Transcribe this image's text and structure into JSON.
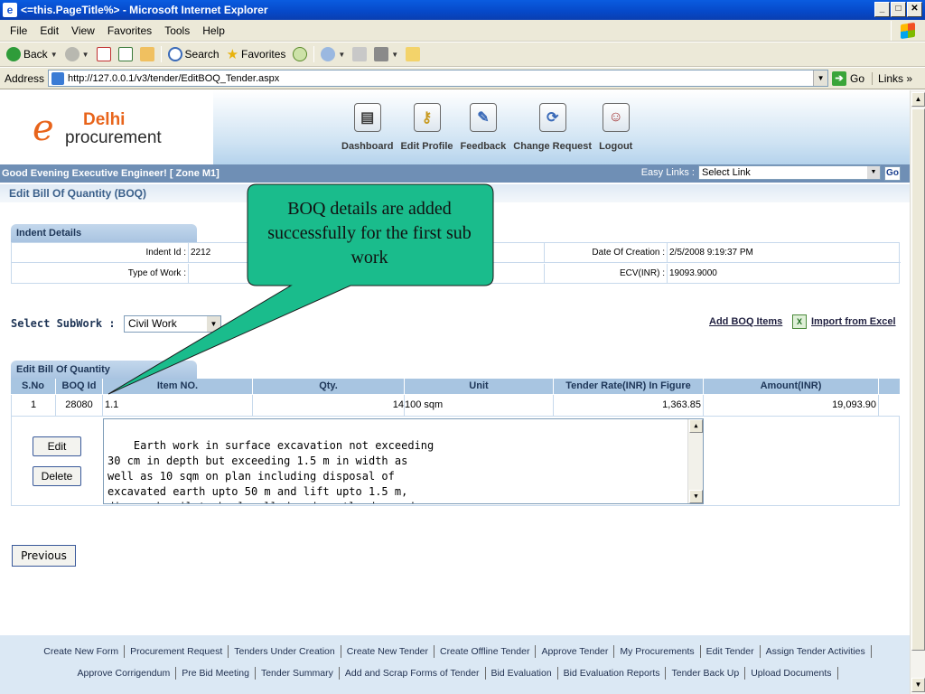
{
  "window": {
    "title": "<=this.PageTitle%> - Microsoft Internet Explorer",
    "min": "_",
    "max": "□",
    "close": "✕"
  },
  "menu": [
    "File",
    "Edit",
    "View",
    "Favorites",
    "Tools",
    "Help"
  ],
  "toolbar": {
    "back": "Back",
    "search": "Search",
    "favorites": "Favorites"
  },
  "address": {
    "label": "Address",
    "url": "http://127.0.0.1/v3/tender/EditBOQ_Tender.aspx",
    "go": "Go",
    "links": "Links"
  },
  "logo": {
    "line1": "Delhi",
    "line2": "procurement",
    "e_letter": "e"
  },
  "nav": [
    {
      "label": "Dashboard",
      "icon": "dashboard-icon"
    },
    {
      "label": "Edit Profile",
      "icon": "key-icon"
    },
    {
      "label": "Feedback",
      "icon": "feedback-icon"
    },
    {
      "label": "Change Request",
      "icon": "change-request-icon"
    },
    {
      "label": "Logout",
      "icon": "logout-icon"
    }
  ],
  "greeting": "Good Evening Executive Engineer!  [ Zone M1]",
  "easy_links": {
    "label": "Easy Links :",
    "selected": "Select Link",
    "go": "Go"
  },
  "page_title": "Edit Bill Of Quantity (BOQ)",
  "indent": {
    "section": "Indent Details",
    "indent_id_label": "Indent Id :",
    "indent_id": "2212",
    "type_label": "Type of Work :",
    "type": "",
    "creation_label": "Date Of Creation :",
    "creation": "2/5/2008 9:19:37 PM",
    "ecv_label": "ECV(INR) :",
    "ecv": "19093.9000"
  },
  "subwork": {
    "label": "Select SubWork :",
    "selected": "Civil Work",
    "add_boq": "Add BOQ Items",
    "import_excel": "Import from Excel"
  },
  "boq": {
    "section": "Edit Bill Of Quantity",
    "columns": [
      "S.No",
      "BOQ Id",
      "Item NO.",
      "Qty.",
      "Unit",
      "Tender Rate(INR) In Figure",
      "Amount(INR)"
    ],
    "row": {
      "sno": "1",
      "boq_id": "28080",
      "item_no": "1.1",
      "qty": "14",
      "unit": "100 sqm",
      "rate": "1,363.85",
      "amount": "19,093.90"
    },
    "description": "Earth work in surface excavation not exceeding\n30 cm in depth but exceeding 1.5 m in width as\nwell as 10 sqm on plan including disposal of\nexcavated earth upto 50 m and lift upto 1.5 m,\ndisposed soil to be levelled and neatly dressed",
    "edit": "Edit",
    "delete": "Delete"
  },
  "previous": "Previous",
  "callout": "BOQ details are added successfully for the first sub work",
  "footer": {
    "row1": [
      "Create New Form",
      "Procurement Request",
      "Tenders Under Creation",
      "Create New Tender",
      "Create Offline Tender",
      "Approve Tender",
      "My Procurements",
      "Edit Tender",
      "Assign Tender Activities"
    ],
    "row2": [
      "Approve Corrigendum",
      "Pre Bid Meeting",
      "Tender Summary",
      "Add and Scrap Forms of Tender",
      "Bid Evaluation",
      "Bid Evaluation Reports",
      "Tender Back Up",
      "Upload Documents"
    ]
  },
  "colors": {
    "callout_fill": "#1abc8c",
    "header_band": "#b5d3ec",
    "greet_bar": "#6f8fb5",
    "logo_orange": "#e8641b"
  }
}
